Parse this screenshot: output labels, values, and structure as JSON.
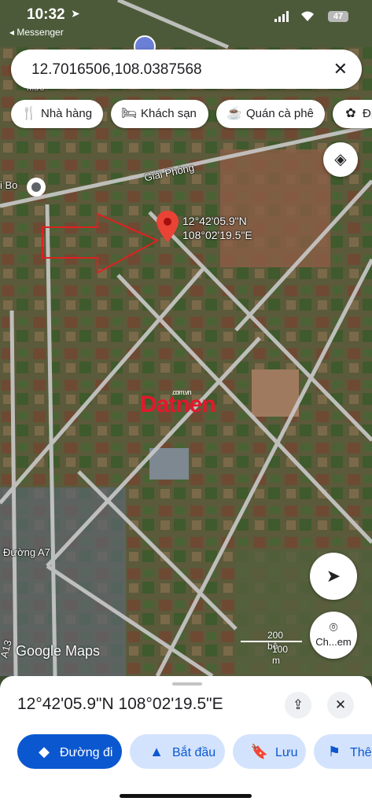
{
  "status_bar": {
    "time": "10:32",
    "back_app": "◂ Messenger",
    "battery": "47"
  },
  "search": {
    "query": "12.7016506,108.0387568",
    "clear_icon": "close-icon"
  },
  "chips": [
    {
      "label": "Nhà hàng",
      "icon": "restaurant-icon"
    },
    {
      "label": "Khách sạn",
      "icon": "hotel-icon"
    },
    {
      "label": "Quán cà phê",
      "icon": "cafe-icon"
    },
    {
      "label": "Đị",
      "icon": "attraction-icon"
    }
  ],
  "map": {
    "pin_lat": "12°42'05.9\"N",
    "pin_lng": "108°02'19.5\"E",
    "streets": [
      "Giải Phóng",
      "Đường A7",
      "A13",
      "i Bo",
      "Mươ"
    ],
    "watermark": "Datnen",
    "watermark_small": ".com.vn",
    "google_logo": "Google Maps",
    "scale_top": "200 bộ",
    "scale_bottom": "100 m",
    "chip_search_label": "Ch...em",
    "accent_red": "#ea4335"
  },
  "sheet": {
    "title": "12°42'05.9\"N 108°02'19.5\"E",
    "actions": [
      {
        "label": "Đường đi",
        "icon": "directions-icon"
      },
      {
        "label": "Bắt đầu",
        "icon": "navigation-icon"
      },
      {
        "label": "Lưu",
        "icon": "bookmark-icon"
      },
      {
        "label": "Thê",
        "icon": "flag-icon"
      }
    ]
  }
}
